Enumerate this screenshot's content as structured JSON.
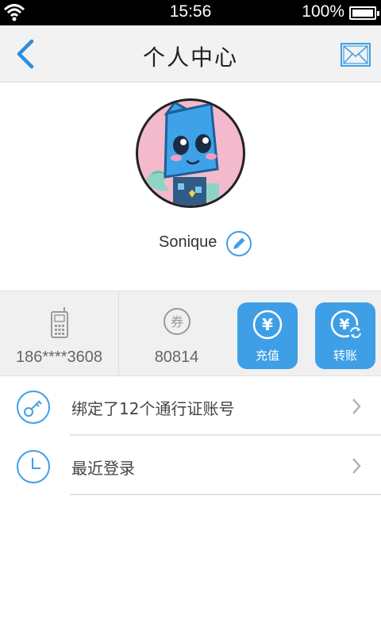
{
  "status_bar": {
    "time": "15:56",
    "battery_text": "100%",
    "icons": [
      "wifi-icon",
      "battery-icon"
    ]
  },
  "header": {
    "title": "个人中心",
    "back_icon": "chevron-left-icon",
    "mail_icon": "envelope-icon"
  },
  "profile": {
    "nickname": "Sonique",
    "avatar_icon": "robot-avatar",
    "edit_icon": "pencil-icon"
  },
  "account": {
    "phone": "186****3608",
    "phone_icon": "mobile-phone-icon",
    "coupon_glyph": "券",
    "coupon_value": "80814"
  },
  "actions": {
    "recharge_label": "充值",
    "transfer_label": "转账",
    "currency_glyph": "¥"
  },
  "list": {
    "items": [
      {
        "label": "绑定了12个通行证账号",
        "icon": "key-icon"
      },
      {
        "label": "最近登录",
        "icon": "clock-icon"
      }
    ]
  },
  "colors": {
    "accent": "#3f9fe6",
    "header_bg": "#f2f2f2",
    "strip_bg": "#f0f0f0",
    "avatar_bg": "#f3b9cc"
  }
}
